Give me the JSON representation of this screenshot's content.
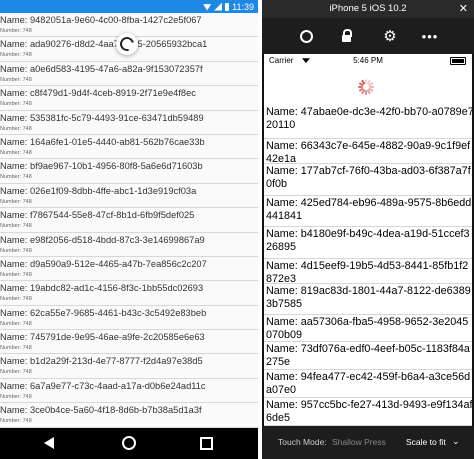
{
  "android": {
    "status_time": "11:39",
    "items": [
      {
        "name": "Name: 9482051a-9e60-4c00-8fba-1427c2e5f067",
        "number": "Number: 748"
      },
      {
        "name": "Name: ada90276-d8d2-4aa7-a895-20565932bca1",
        "number": "Number: 748"
      },
      {
        "name": "Name: a0e6d583-4195-47a6-a82a-9f153072357f",
        "number": "Number: 748"
      },
      {
        "name": "Name: c8f479d1-9d4f-4ceb-8919-2f71e9e4f8ec",
        "number": "Number: 748"
      },
      {
        "name": "Name: 535381fc-5c79-4493-91ce-63471db59489",
        "number": "Number: 748"
      },
      {
        "name": "Name: 164a6fe1-01e5-4440-ab81-562b76cae33b",
        "number": "Number: 748"
      },
      {
        "name": "Name: bf9ae967-10b1-4956-80f8-5a6e6d71603b",
        "number": "Number: 748"
      },
      {
        "name": "Name: 026e1f09-8dbb-4ffe-abc1-1d3e919cf03a",
        "number": "Number: 748"
      },
      {
        "name": "Name: f7867544-55e8-47cf-8b1d-6fb9f5def025",
        "number": "Number: 748"
      },
      {
        "name": "Name: e98f2056-d518-4bdd-87c3-3e14699867a9",
        "number": "Number: 748"
      },
      {
        "name": "Name: d9a590a9-512e-4465-a47b-7ea856c2c207",
        "number": "Number: 748"
      },
      {
        "name": "Name: 19abdc82-ad1c-4156-8f3c-1bb55dc02693",
        "number": "Number: 748"
      },
      {
        "name": "Name: 62ca55e7-9685-4461-b43c-3c5492e83beb",
        "number": "Number: 748"
      },
      {
        "name": "Name: 745791de-9e95-46ae-a9fe-2c20585e6e63",
        "number": "Number: 748"
      },
      {
        "name": "Name: b1d2a29f-213d-4e77-8777-f2d4a97e38d5",
        "number": "Number: 748"
      },
      {
        "name": "Name: 6a7a9e77-c73c-4aad-a17a-d0b6e24ad11c",
        "number": "Number: 748"
      },
      {
        "name": "Name: 3ce0b4ce-5a60-4f18-8d6b-b7b38a5d1a3f",
        "number": "Number: 748"
      }
    ]
  },
  "simulator": {
    "title": "iPhone 5 iOS 10.2",
    "close_glyph": "✕",
    "toolbar": {
      "settings_glyph": "⚙",
      "more_glyph": "•••"
    },
    "status": {
      "carrier": "Carrier",
      "time": "5:46 PM"
    },
    "items": [
      {
        "text": "Name: 47abae0e-dc3e-42f0-bb70-a0789e720110",
        "h": 34
      },
      {
        "text": "Name: 66343c7e-645e-4882-90a9-9c1f9ef42e1a",
        "h": 25
      },
      {
        "text": "Name: 177ab7cf-76f0-43ba-ad03-6f387a7f0f0b",
        "h": 32
      },
      {
        "text": "Name: 425ed784-eb96-489a-9575-8b6edd441841",
        "h": 31
      },
      {
        "text": "Name: b4180e9f-b49c-4dea-a19d-51ccef326895",
        "h": 32
      },
      {
        "text": "Name: 4d15eef9-19b5-4d53-8441-85fb1f2872e3",
        "h": 25
      },
      {
        "text": "Name: 819ac83d-1801-44a7-8122-de63893b7585",
        "h": 31
      },
      {
        "text": "Name: aa57306a-fba5-4958-9652-3e2045070b09",
        "h": 27
      },
      {
        "text": "Name: 73df076a-edf0-4eef-b05c-1183f84a275e",
        "h": 28
      },
      {
        "text": "Name: 94fea477-ec42-459f-b6a4-a3ce56da07e0",
        "h": 28
      },
      {
        "text": "Name: 957cc5bc-fe27-413d-9493-e9f134af6de5",
        "h": 28
      }
    ],
    "bottom": {
      "touch_mode_label": "Touch Mode:",
      "touch_mode_value": "Shallow Press",
      "scale_label": "Scale to fit",
      "scale_caret": "⌄"
    }
  }
}
